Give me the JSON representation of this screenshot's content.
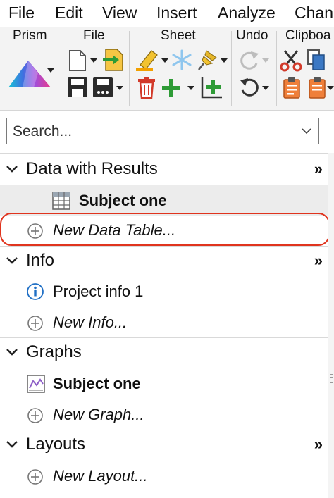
{
  "menu": {
    "file": "File",
    "edit": "Edit",
    "view": "View",
    "insert": "Insert",
    "analyze": "Analyze",
    "change": "Chan"
  },
  "ribbon": {
    "prism": "Prism",
    "file": "File",
    "sheet": "Sheet",
    "undo": "Undo",
    "clipboard": "Clipboa"
  },
  "search": {
    "placeholder": "Search..."
  },
  "navigator": {
    "data_section": "Data with Results",
    "data_item": "Subject one",
    "new_data_table": "New Data Table...",
    "info_section": "Info",
    "info_item": "Project info 1",
    "new_info": "New Info...",
    "graphs_section": "Graphs",
    "graph_item": "Subject one",
    "new_graph": "New Graph...",
    "layouts_section": "Layouts",
    "new_layout": "New Layout...",
    "more": "»"
  },
  "colors": {
    "highlight_ring": "#e0341e",
    "selected_row": "#ececec",
    "info_icon": "#1f6fc5",
    "add_green": "#2e9b36",
    "delete_red": "#d23a2a"
  }
}
